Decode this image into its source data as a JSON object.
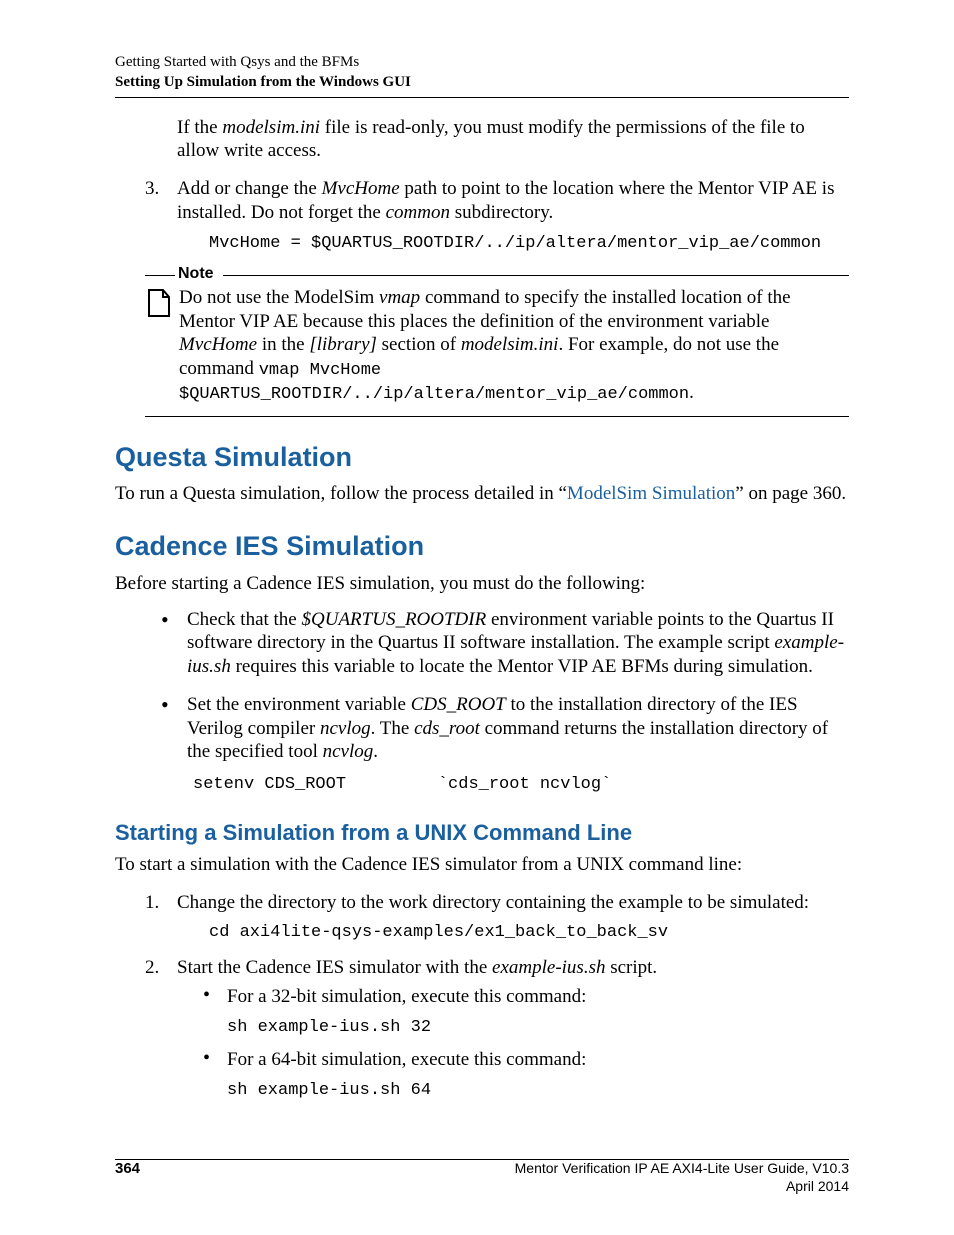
{
  "header": {
    "line1": "Getting Started with Qsys and the BFMs",
    "line2": "Setting Up Simulation from the Windows GUI"
  },
  "top": {
    "para1_a": "If the ",
    "para1_i": "modelsim.ini",
    "para1_b": " file is read-only, you must modify the permissions of the file to allow write access.",
    "step3_num": "3.",
    "step3_a": "Add or change the ",
    "step3_i1": "MvcHome",
    "step3_b": " path to point to the location where the Mentor VIP AE is installed. Do not forget the ",
    "step3_i2": "common",
    "step3_c": " subdirectory.",
    "code1": "MvcHome = $QUARTUS_ROOTDIR/../ip/altera/mentor_vip_ae/common"
  },
  "note": {
    "label": "Note",
    "t1": "Do not use the ModelSim ",
    "i1": "vmap",
    "t2": " command to specify the installed location of the Mentor VIP AE because this places the definition of the environment variable ",
    "i2": "MvcHome",
    "t3": " in the ",
    "i3": "[library]",
    "t4": " section of ",
    "i4": "modelsim.ini",
    "t5": ". For example, do not use the command ",
    "m1": "vmap MvcHome $QUARTUS_ROOTDIR/../ip/altera/mentor_vip_ae/common",
    "t6": "."
  },
  "questa": {
    "heading": "Questa Simulation",
    "p_a": "To run a Questa simulation, follow the process detailed in “",
    "p_link": "ModelSim Simulation",
    "p_b": "” on page 360."
  },
  "cadence": {
    "heading": "Cadence IES Simulation",
    "intro": "Before starting a Cadence IES simulation, you must do the following:",
    "b1_a": "Check that the ",
    "b1_i": "$QUARTUS_ROOTDIR",
    "b1_b": " environment variable points to the Quartus II software directory in the Quartus II software installation. The example script ",
    "b1_i2": "example-ius.sh",
    "b1_c": " requires this variable to locate the Mentor VIP AE BFMs during simulation.",
    "b2_a": "Set the environment variable ",
    "b2_i1": "CDS_ROOT",
    "b2_b": " to the installation directory of the IES Verilog compiler ",
    "b2_i2": "ncvlog",
    "b2_c": ". The ",
    "b2_i3": "cds_root",
    "b2_d": " command returns the installation directory of the specified tool ",
    "b2_i4": "ncvlog",
    "b2_e": ".",
    "code_setenv": "setenv CDS_ROOT         `cds_root ncvlog`"
  },
  "unix": {
    "heading": "Starting a Simulation from a UNIX Command Line",
    "intro": "To start a simulation with the Cadence IES simulator from a UNIX command line:",
    "s1_num": "1.",
    "s1_text": "Change the directory to the work directory containing the example to be simulated:",
    "s1_code": "cd axi4lite-qsys-examples/ex1_back_to_back_sv",
    "s2_num": "2.",
    "s2_a": "Start the Cadence IES simulator with the ",
    "s2_i": "example-ius.sh",
    "s2_b": " script.",
    "s2_sub1": "For a 32-bit simulation, execute this command:",
    "s2_sub1_code": "sh example-ius.sh 32",
    "s2_sub2": "For a 64-bit simulation, execute this command:",
    "s2_sub2_code": "sh example-ius.sh 64"
  },
  "footer": {
    "page": "364",
    "right1": "Mentor Verification IP AE AXI4-Lite User Guide, V10.3",
    "right2": "April 2014"
  }
}
